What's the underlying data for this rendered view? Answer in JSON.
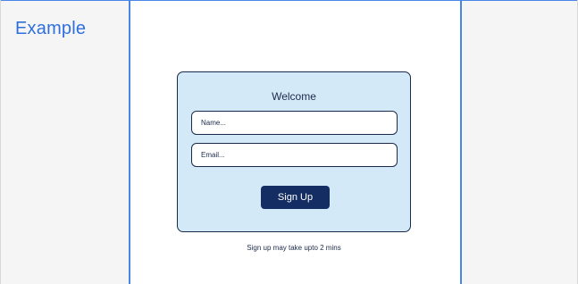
{
  "app": {
    "title": "Example"
  },
  "form": {
    "heading": "Welcome",
    "name_placeholder": "Name...",
    "email_placeholder": "Email...",
    "submit_label": "Sign Up",
    "note": "Sign up may take upto 2 mins"
  },
  "colors": {
    "accent": "#4a86e8",
    "title": "#2f6fdc",
    "card_background": "#d3e9f8",
    "card_border": "#1b2a4a",
    "button": "#142e63",
    "side_panel": "#f5f5f5"
  }
}
